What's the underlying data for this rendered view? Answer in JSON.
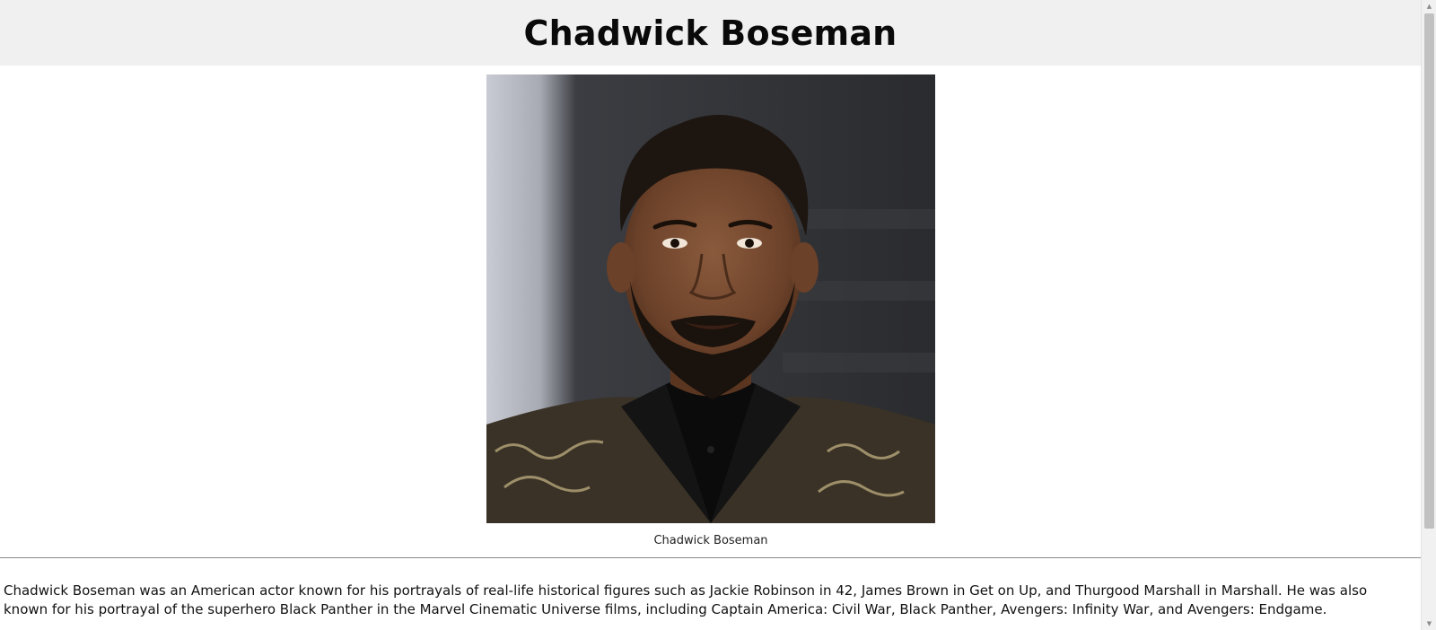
{
  "header": {
    "title": "Chadwick Boseman"
  },
  "figure": {
    "image_alt": "Chadwick Boseman",
    "caption": "Chadwick Boseman"
  },
  "bio": {
    "text": "Chadwick Boseman was an American actor known for his portrayals of real-life historical figures such as Jackie Robinson in 42, James Brown in Get on Up, and Thurgood Marshall in Marshall. He was also known for his portrayal of the superhero Black Panther in the Marvel Cinematic Universe films, including Captain America: Civil War, Black Panther, Avengers: Infinity War, and Avengers: Endgame."
  },
  "scrollbar": {
    "up_icon": "arrow-up-icon",
    "down_icon": "arrow-down-icon"
  },
  "colors": {
    "header_bg": "#f0f0f0",
    "divider": "#8a8a8a",
    "scrollbar_thumb": "#c1c1c1"
  }
}
